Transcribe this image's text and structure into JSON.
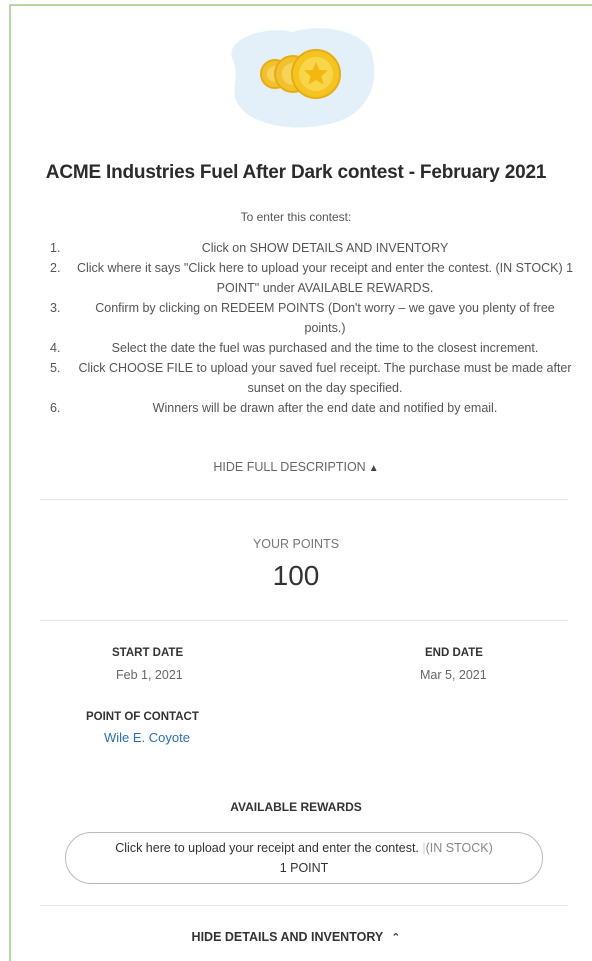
{
  "contest": {
    "title": "ACME Industries Fuel After Dark contest - February 2021",
    "intro": "To enter this contest:",
    "steps": [
      {
        "num": "1.",
        "text": "Click on SHOW DETAILS AND INVENTORY"
      },
      {
        "num": "2.",
        "text": "Click where it says \"Click here to upload your receipt and enter the contest. (IN STOCK) 1 POINT\" under AVAILABLE REWARDS."
      },
      {
        "num": "3.",
        "text": "Confirm by clicking on REDEEM POINTS (Don't worry – we gave you plenty of free points.)"
      },
      {
        "num": "4.",
        "text": "Select the date the fuel was purchased and the time to the closest increment."
      },
      {
        "num": "5.",
        "text": "Click CHOOSE FILE to upload your saved fuel receipt. The purchase must be made after sunset on the day specified."
      },
      {
        "num": "6.",
        "text": "Winners will be drawn after the end date and notified by email."
      }
    ],
    "hide_description_label": "HIDE FULL DESCRIPTION"
  },
  "points": {
    "label": "YOUR POINTS",
    "value": "100"
  },
  "details": {
    "start_date_label": "START DATE",
    "start_date": "Feb 1, 2021",
    "end_date_label": "END DATE",
    "end_date": "Mar 5, 2021",
    "contact_label": "POINT OF CONTACT",
    "contact_name": "Wile E. Coyote"
  },
  "rewards": {
    "title": "AVAILABLE REWARDS",
    "item_text": "Click here to upload your receipt and enter the contest.",
    "item_separator": "|",
    "item_stock": "(IN STOCK)",
    "item_cost": "1 POINT"
  },
  "footer": {
    "hide_details_label": "HIDE DETAILS AND INVENTORY"
  },
  "colors": {
    "accent_link": "#2a6fb5",
    "coin": "#f2c12e",
    "cloud": "#e3f0fa",
    "frame_border": "#b8d7a8"
  }
}
